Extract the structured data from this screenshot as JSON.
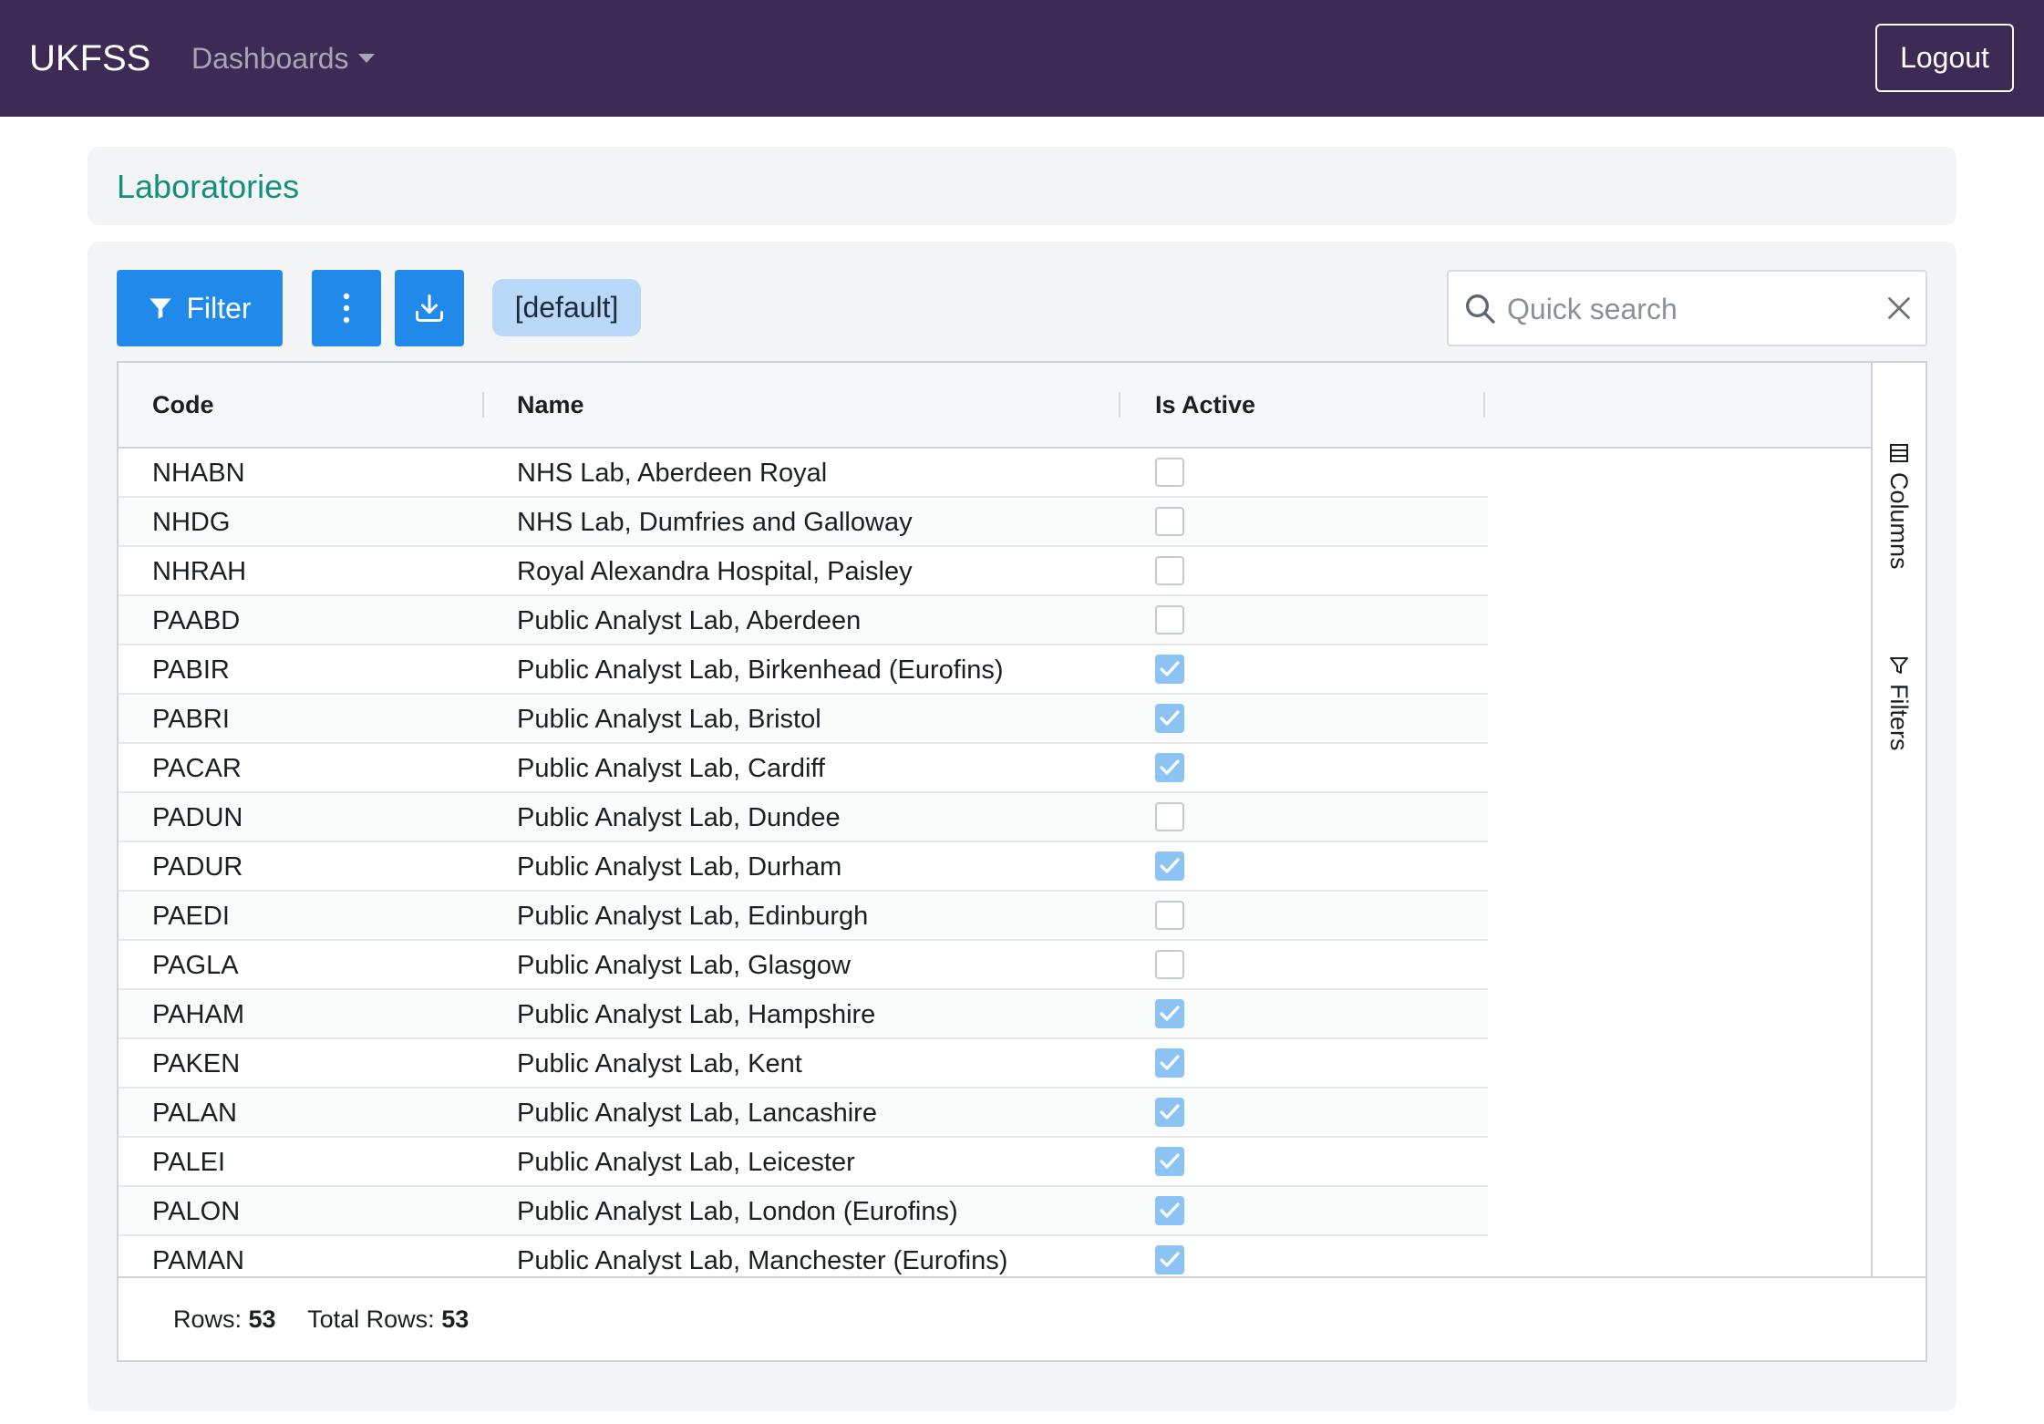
{
  "navbar": {
    "brand": "UKFSS",
    "dashboards_label": "Dashboards",
    "logout_label": "Logout",
    "background": "#3d2b55"
  },
  "page": {
    "title": "Laboratories",
    "title_color": "#148f7c"
  },
  "toolbar": {
    "filter_label": "Filter",
    "preset_label": "[default]",
    "search_placeholder": "Quick search",
    "accent": "#2189ea",
    "icons": [
      "filter-icon",
      "more-vertical-icon",
      "download-icon",
      "search-icon",
      "close-icon"
    ]
  },
  "grid": {
    "columns": [
      "Code",
      "Name",
      "Is Active"
    ],
    "rows": [
      {
        "code": "NHABN",
        "name": "NHS Lab, Aberdeen Royal",
        "active": false
      },
      {
        "code": "NHDG",
        "name": "NHS Lab, Dumfries and Galloway",
        "active": false
      },
      {
        "code": "NHRAH",
        "name": "Royal Alexandra Hospital, Paisley",
        "active": false
      },
      {
        "code": "PAABD",
        "name": "Public Analyst Lab, Aberdeen",
        "active": false
      },
      {
        "code": "PABIR",
        "name": "Public Analyst Lab, Birkenhead (Eurofins)",
        "active": true
      },
      {
        "code": "PABRI",
        "name": "Public Analyst Lab, Bristol",
        "active": true
      },
      {
        "code": "PACAR",
        "name": "Public Analyst Lab, Cardiff",
        "active": true
      },
      {
        "code": "PADUN",
        "name": "Public Analyst Lab, Dundee",
        "active": false
      },
      {
        "code": "PADUR",
        "name": "Public Analyst Lab, Durham",
        "active": true
      },
      {
        "code": "PAEDI",
        "name": "Public Analyst Lab, Edinburgh",
        "active": false
      },
      {
        "code": "PAGLA",
        "name": "Public Analyst Lab, Glasgow",
        "active": false
      },
      {
        "code": "PAHAM",
        "name": "Public Analyst Lab, Hampshire",
        "active": true
      },
      {
        "code": "PAKEN",
        "name": "Public Analyst Lab, Kent",
        "active": true
      },
      {
        "code": "PALAN",
        "name": "Public Analyst Lab, Lancashire",
        "active": true
      },
      {
        "code": "PALEI",
        "name": "Public Analyst Lab, Leicester",
        "active": true
      },
      {
        "code": "PALON",
        "name": "Public Analyst Lab, London (Eurofins)",
        "active": true
      },
      {
        "code": "PAMAN",
        "name": "Public Analyst Lab, Manchester (Eurofins)",
        "active": true
      }
    ],
    "sidebar": {
      "columns_label": "Columns",
      "filters_label": "Filters"
    },
    "footer": {
      "rows_label": "Rows:",
      "rows_value": "53",
      "total_label": "Total Rows:",
      "total_value": "53"
    }
  }
}
